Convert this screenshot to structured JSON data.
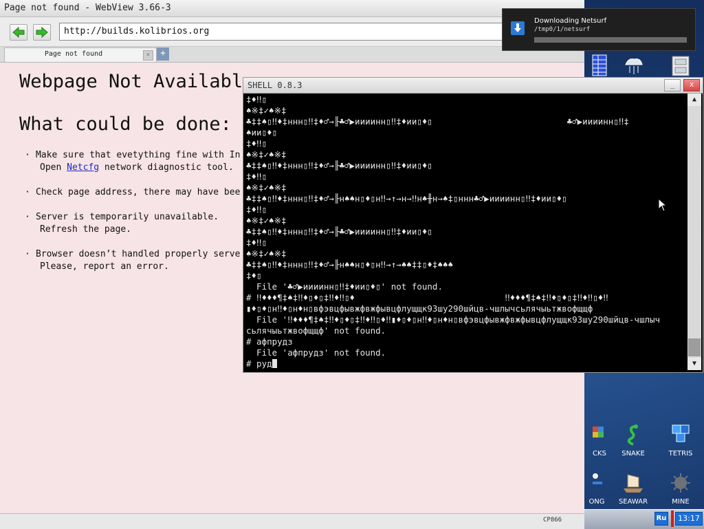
{
  "browser": {
    "window_title": "Page not found - WebView 3.66-3",
    "url": "http://builds.kolibrios.org",
    "tab_label": "Page not found",
    "tab_close": "×",
    "new_tab": "+",
    "heading": "Webpage Not Available",
    "subheading": "What could be done:",
    "bullet": "·",
    "items": [
      {
        "line1": "Make sure that evetything fine with In",
        "line2_pre": "Open ",
        "line2_link": "Netcfg",
        "line2_post": " network diagnostic tool."
      },
      {
        "line1": "Check page address, there may have bee",
        "line2_pre": "",
        "line2_link": "",
        "line2_post": ""
      },
      {
        "line1": "Server is temporarily unavailable.",
        "line2_pre": "Refresh the page.",
        "line2_link": "",
        "line2_post": ""
      },
      {
        "line1": "Browser doesn’t handled properly serve",
        "line2_pre": "Please, report an error.",
        "line2_link": "",
        "line2_post": ""
      }
    ],
    "status_encoding": "CP866"
  },
  "notification": {
    "title": "Downloading Netsurf",
    "path": "/tmp0/1/netsurf",
    "progress": 0.0,
    "icon": "download-arrow-icon"
  },
  "shell": {
    "title": "SHELL 0.8.3",
    "minimize": "_",
    "close": "x",
    "lines": [
      "‡♦‼▯",
      "♠※‡✓♠※‡",
      "♣‡‡♠▯‼♦‡ннн▯‼‡♦♂→╟♣♂▶иииинн▯‼‡♦ии▯♦▯                          ♣♂▶иииинн▯‼‡",
      "♠ии▯♦▯",
      "‡♦‼▯",
      "♠※‡✓♠※‡",
      "♣‡‡♠▯‼♦‡ннн▯‼‡♦♂→╟♣♂▶иииинн▯‼‡♦ии▯♦▯",
      "‡♦‼▯",
      "♠※‡✓♠※‡",
      "♣‡‡♠▯‼♦‡ннн▯‼‡♦♂→╟н♠♠н▯♦▯н‼→↑→н→‼н♠╫н→♠‡▯ннн♣♂▶иииинн▯‼‡♦ии▯♦▯",
      "‡♦‼▯",
      "♠※‡✓♠※‡",
      "♣‡‡♠▯‼♦‡ннн▯‼‡♦♂→╟♣♂▶иииинн▯‼‡♦ии▯♦▯",
      "‡♦‼▯",
      "♠※‡✓♠※‡",
      "♣‡‡♠▯‼♦‡ннн▯‼‡♦♂→╟н♠♠н▯♦▯н‼→↑→♠♠‡‡▯♦‡♠♠♠",
      "‡♦▯",
      "  File '♣♂▶иииинн▯‼‡♦ии▯♦▯' not found.",
      "# ‼♦♦♦¶‡♠‡‼♦▯♦▯‡‼♦‼▯♦                             ‼♦♦♦¶‡♠‡‼♦▯♦▯‡‼♦‼▯♦‼",
      "▮♦▯♦▯н‼♦▯н♦н▯вфэвцфывжфвжфывцфлущщк93шу290шйцв-чшлычсьлячыьтжвофщщф",
      "  File '‼♦♦♦¶‡♠‡‼♦▯♦▯‡‼♦‼▯♦‼▮♦▯♦▯н‼♦▯н♦н▯вфэвцфывжфвжфывцфлущщк93шу290шйцв-чшлыч",
      "сьлячыьтжвофщщф' not found.",
      "# афпрудз",
      "  File 'афпрудз' not found.",
      "# руд"
    ]
  },
  "desktop_icons": [
    {
      "label": "",
      "icon": "table-icon"
    },
    {
      "label": "",
      "icon": "cloud-network-icon"
    },
    {
      "label": "",
      "icon": "cabinet-icon"
    },
    {
      "label": "CKS",
      "icon": "blocks-icon"
    },
    {
      "label": "SNAKE",
      "icon": "snake-icon"
    },
    {
      "label": "TETRIS",
      "icon": "tetris-icon"
    },
    {
      "label": "ONG",
      "icon": "pong-icon"
    },
    {
      "label": "SEAWAR",
      "icon": "seawar-icon"
    },
    {
      "label": "MINE",
      "icon": "mine-icon"
    }
  ],
  "taskbar": {
    "lang": "Ru",
    "clock": "13:17"
  }
}
